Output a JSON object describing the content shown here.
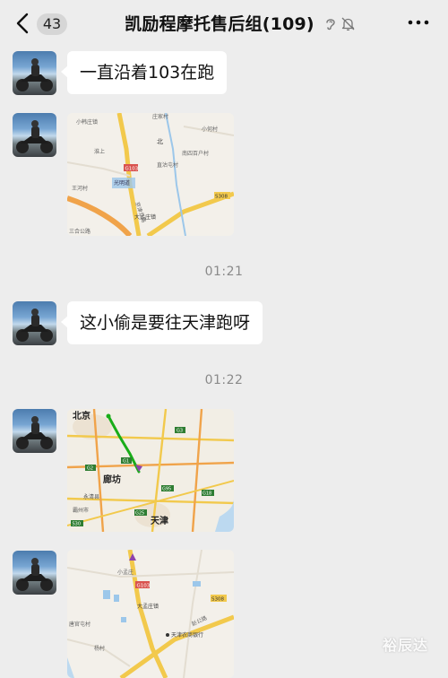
{
  "header": {
    "back_icon": "chevron-left-icon",
    "unread_count": "43",
    "title": "凯励程摩托售后组(109)",
    "status_icons": [
      "ear-icon",
      "bell-muted-icon"
    ],
    "more_icon": "more-dots-icon"
  },
  "messages": [
    {
      "type": "text",
      "text": "一直沿着103在跑"
    },
    {
      "type": "map",
      "labels": {
        "a": "小韩庄镇",
        "b": "庄家村",
        "c": "小何村",
        "d": "淮上",
        "e": "北",
        "f": "南四百户村",
        "g": "直沽屯村",
        "h": "G103",
        "i": "S308",
        "j": "大孟庄镇",
        "k": "王河村",
        "l": "三合公路",
        "m": "光明道",
        "n": "京津公路"
      }
    },
    {
      "type": "time",
      "text": "01:21"
    },
    {
      "type": "text",
      "text": "这小偷是要往天津跑呀"
    },
    {
      "type": "time",
      "text": "01:22"
    },
    {
      "type": "map",
      "labels": {
        "city1": "北京",
        "city2": "廊坊",
        "city3": "天津",
        "r1": "G1",
        "r2": "G2",
        "r3": "G3",
        "r4": "G18",
        "r5": "G25",
        "r6": "S30",
        "r7": "G95",
        "r8": "永清县",
        "r9": "霸州市"
      }
    },
    {
      "type": "map",
      "labels": {
        "a": "小孟庄",
        "b": "S308",
        "c": "G103",
        "d": "大孟庄镇",
        "e": "唐官屯村",
        "f": "杨村",
        "g": "天津农商银行",
        "h": "赵公路"
      }
    }
  ],
  "watermark": "裕辰达",
  "colors": {
    "background": "#ededed",
    "bubble": "#ffffff",
    "timestamp": "#8a8a8a",
    "route_green": "#1aad19",
    "road_yellow": "#f2c94c",
    "road_orange": "#f0a34a"
  }
}
